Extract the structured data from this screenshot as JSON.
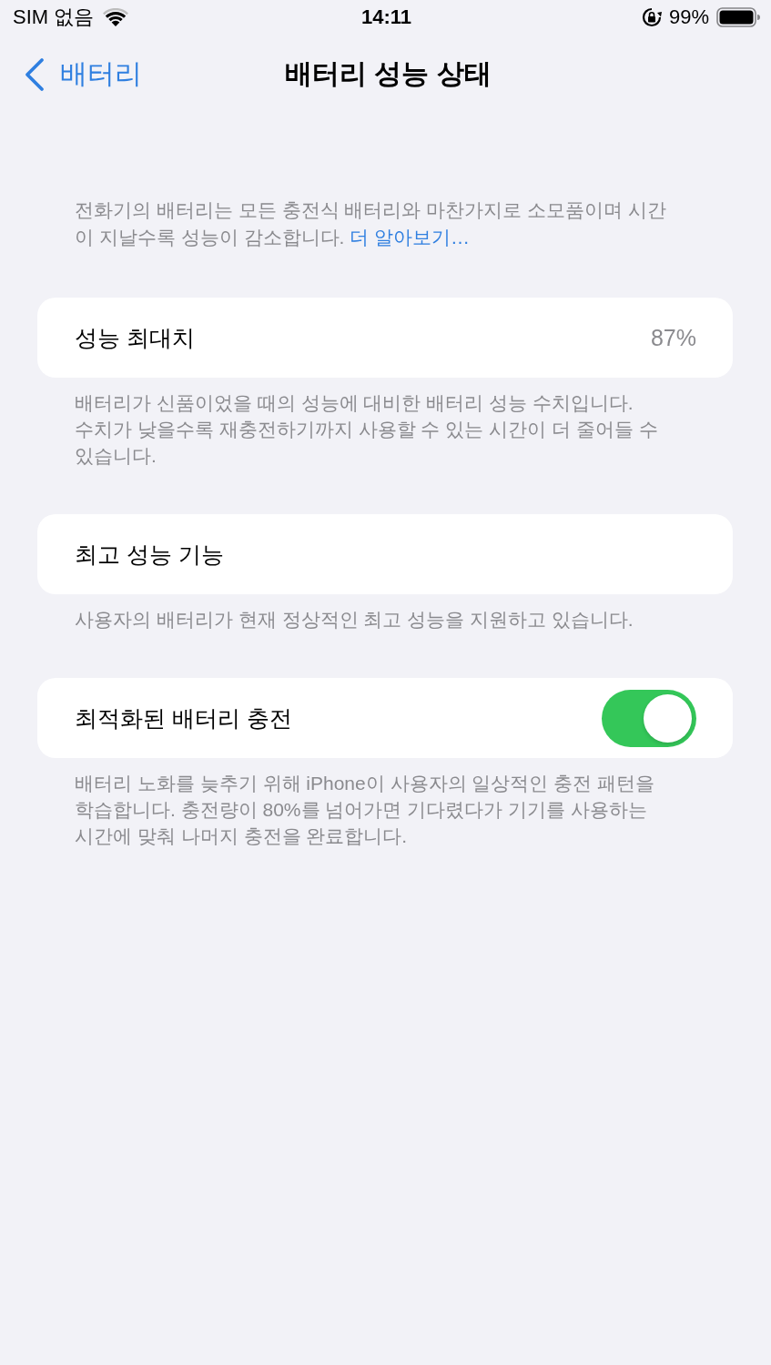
{
  "status_bar": {
    "carrier": "SIM 없음",
    "time": "14:11",
    "battery": "99%"
  },
  "nav_bar": {
    "back": "배터리",
    "title": "배터리 성능 상태"
  },
  "intro": {
    "text": "전화기의 배터리는 모든 충전식 배터리와 마찬가지로 소모품이며 시간이 지날수록 성능이 감소합니다.",
    "link": "더 알아보기…"
  },
  "sections": [
    {
      "kind": "value",
      "label": "성능 최대치",
      "value": "87%",
      "footer": "배터리가 신품이었을 때의 성능에 대비한 배터리 성능 수치입니다. 수치가 낮을수록 재충전하기까지 사용할 수 있는 시간이 더 줄어들 수 있습니다."
    },
    {
      "kind": "plain",
      "label": "최고 성능 기능",
      "footer": "사용자의 배터리가 현재 정상적인 최고 성능을 지원하고 있습니다."
    },
    {
      "kind": "toggle",
      "label": "최적화된 배터리 충전",
      "on": true,
      "footer": "배터리 노화를 늦추기 위해 iPhone이 사용자의 일상적인 충전 패턴을 학습합니다. 충전량이 80%를 넘어가면 기다렸다가 기기를 사용하는 시간에 맞춰 나머지 충전을 완료합니다."
    }
  ]
}
